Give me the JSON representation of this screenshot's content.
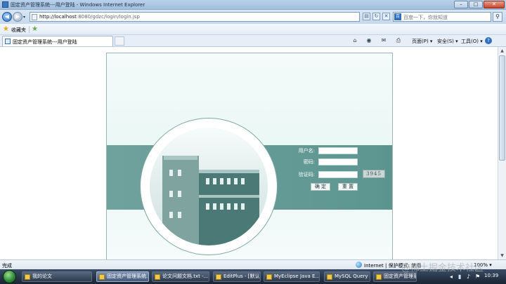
{
  "window": {
    "title": "固定资产管理系统---用户登陆 - Windows Internet Explorer",
    "controls": {
      "minimize": "–",
      "maximize": "□",
      "close": "✕"
    }
  },
  "address": {
    "url_host": "http://localhost",
    "url_rest": ":8080/gdzc/login/login.jsp",
    "search_placeholder": "百度一下，你就知道"
  },
  "favorites": {
    "label": "收藏夹"
  },
  "tab": {
    "title": "固定资产管理系统---用户登陆"
  },
  "commandbar": {
    "page": "页面(P) ▾",
    "safety": "安全(S) ▾",
    "tools": "工具(O) ▾"
  },
  "login": {
    "username_label": "用户名:",
    "password_label": "密码:",
    "captcha_label": "验证码:",
    "username_value": "",
    "password_value": "",
    "captcha_value": "",
    "captcha_image_text": "3945",
    "ok_button": "确 定",
    "reset_button": "重 置"
  },
  "status": {
    "done": "完成",
    "zone": "Internet | 保护模式: 禁用",
    "zoom": "100% ▾"
  },
  "taskbar": {
    "items": [
      {
        "label": "我的论文",
        "active": false
      },
      {
        "label": "固定资产管理系统...",
        "active": true
      },
      {
        "label": "论文问题文档.txt -...",
        "active": false
      },
      {
        "label": "EditPlus - [默认] - [...",
        "active": false
      },
      {
        "label": "MyEclipse Java E...",
        "active": false
      },
      {
        "label": "MySQL Query Br...",
        "active": false
      },
      {
        "label": "固定资产管理系统...",
        "active": false
      }
    ],
    "clock": "10:39"
  },
  "watermark": "@稀土掘金技术社区",
  "colors": {
    "band": "#5c9590",
    "panel_bg": "#eaf7f5",
    "titlebar": "#b9d1ea"
  }
}
